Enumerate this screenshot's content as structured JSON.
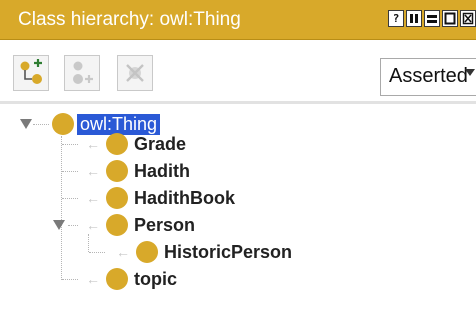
{
  "window": {
    "title": "Class hierarchy: owl:Thing",
    "controls": [
      "help",
      "split",
      "minimize",
      "maximize",
      "close"
    ]
  },
  "toolbar": {
    "add_subclass_icon": "add-subclass-icon",
    "add_sibling_icon": "add-sibling-icon",
    "delete_icon": "delete-class-icon",
    "view_mode": "Asserted"
  },
  "tree": {
    "root": {
      "label": "owl:Thing",
      "selected": true
    },
    "children": [
      {
        "label": "Grade"
      },
      {
        "label": "Hadith"
      },
      {
        "label": "HadithBook"
      },
      {
        "label": "Person",
        "children": [
          {
            "label": "HistoricPerson"
          }
        ]
      },
      {
        "label": "topic"
      }
    ]
  },
  "colors": {
    "titlebar": "#d8a92a",
    "bullet": "#d8a92a",
    "selection": "#2a59d6"
  }
}
